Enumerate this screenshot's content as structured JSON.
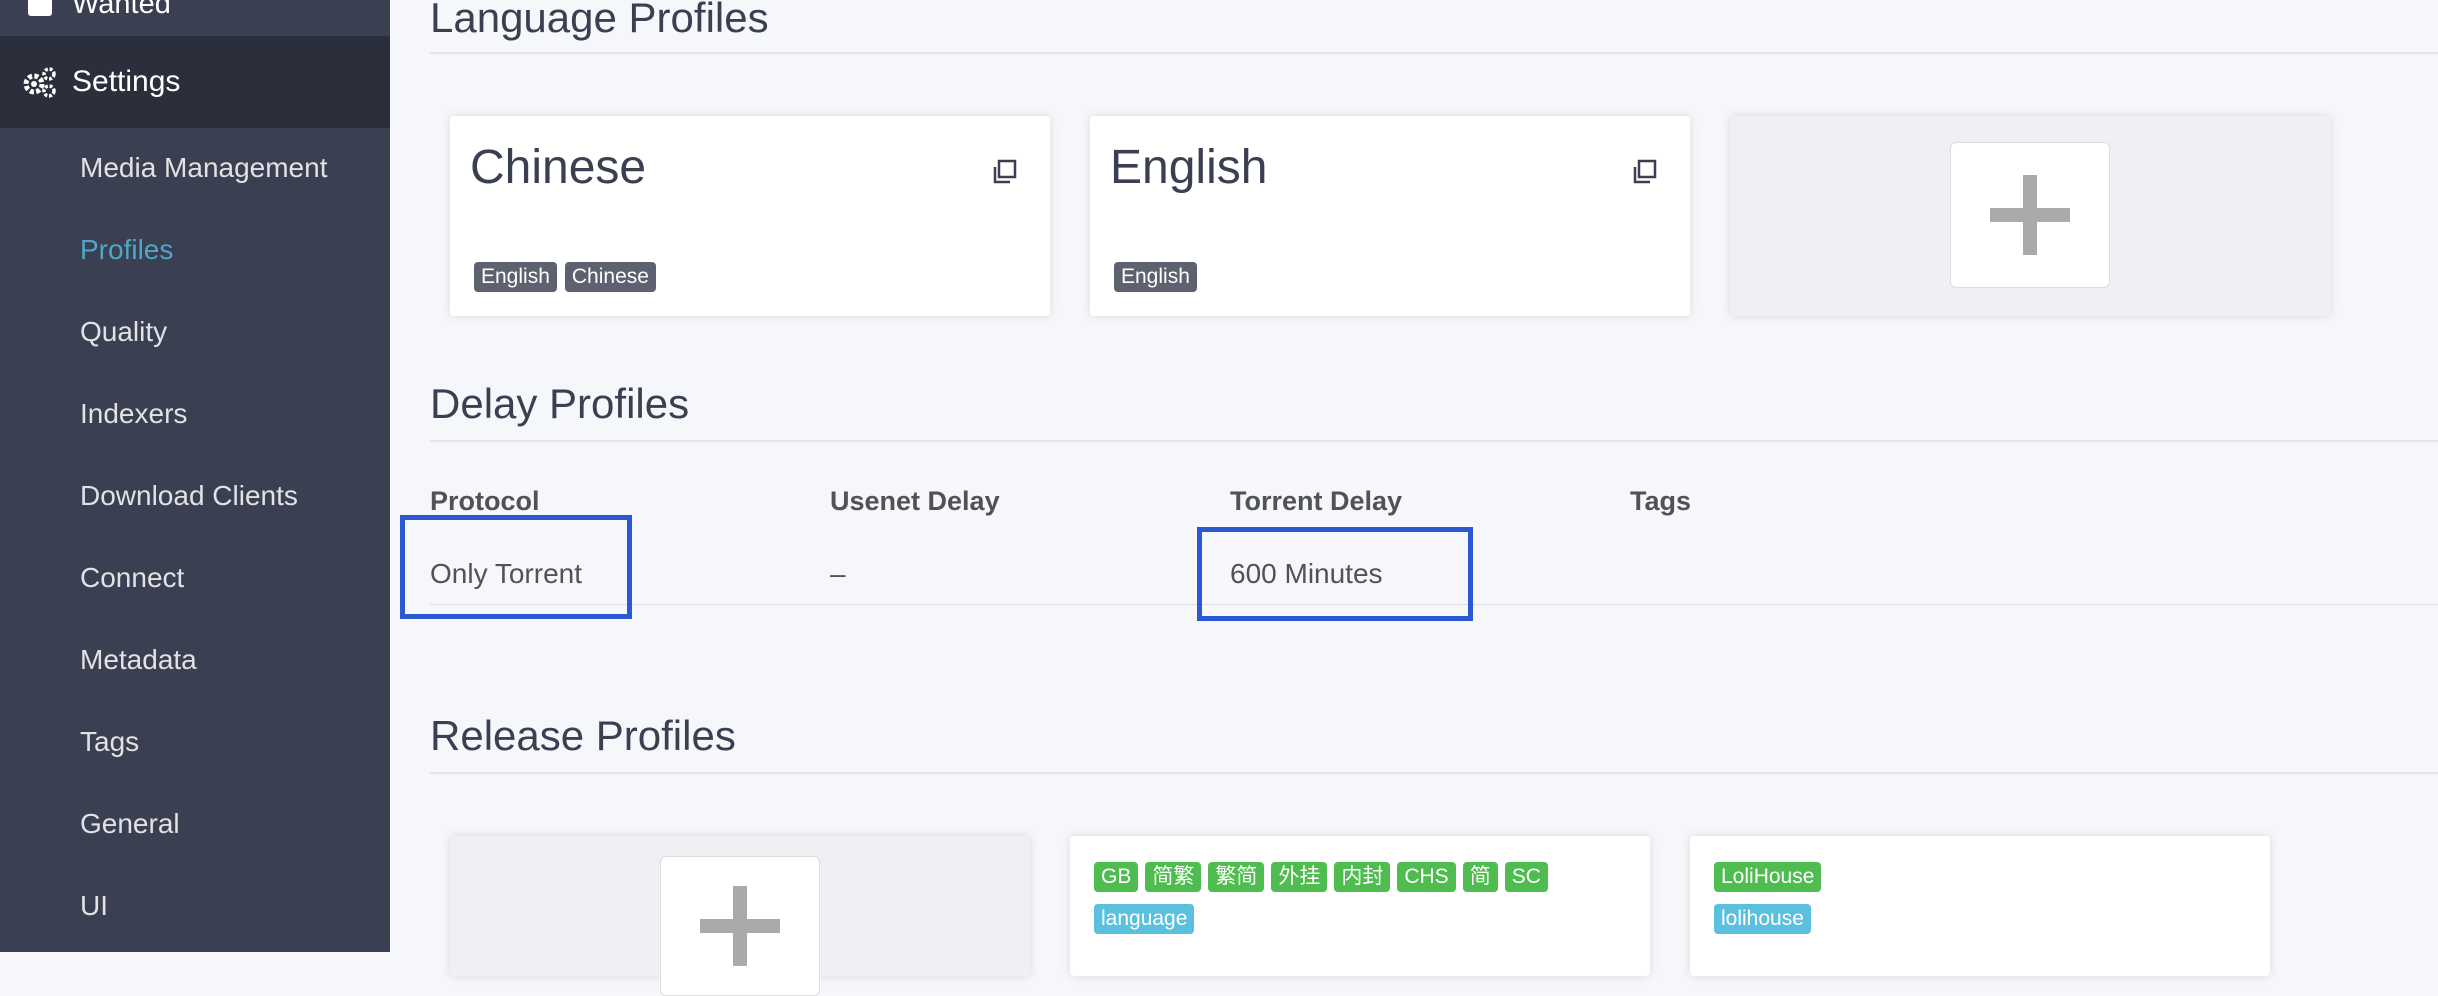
{
  "sidebar": {
    "top_item_label": "Wanted",
    "settings_label": "Settings",
    "items": [
      {
        "label": "Media Management"
      },
      {
        "label": "Profiles"
      },
      {
        "label": "Quality"
      },
      {
        "label": "Indexers"
      },
      {
        "label": "Download Clients"
      },
      {
        "label": "Connect"
      },
      {
        "label": "Metadata"
      },
      {
        "label": "Tags"
      },
      {
        "label": "General"
      },
      {
        "label": "UI"
      }
    ],
    "active_index": 1,
    "colors": {
      "background": "#3a3f51",
      "active_item": "#4fa6c7",
      "settings_bg": "#2b2f3c"
    }
  },
  "language_profiles": {
    "title": "Language Profiles",
    "cards": [
      {
        "name": "Chinese",
        "tags": [
          "English",
          "Chinese"
        ]
      },
      {
        "name": "English",
        "tags": [
          "English"
        ]
      }
    ],
    "add_icon": "plus-icon"
  },
  "delay_profiles": {
    "title": "Delay Profiles",
    "headers": [
      "Protocol",
      "Usenet Delay",
      "Torrent Delay",
      "Tags"
    ],
    "rows": [
      {
        "protocol": "Only Torrent",
        "usenet_delay": "–",
        "torrent_delay": "600 Minutes",
        "tags": ""
      }
    ],
    "highlight_color": "#2b59d1"
  },
  "release_profiles": {
    "title": "Release Profiles",
    "cards": [
      {
        "green_tags": [
          "GB",
          "简繁",
          "繁简",
          "外挂",
          "内封",
          "CHS",
          "简",
          "SC"
        ],
        "blue_tags": [
          "language"
        ]
      },
      {
        "green_tags": [
          "LoliHouse"
        ],
        "blue_tags": [
          "lolihouse"
        ]
      }
    ],
    "add_icon": "plus-icon"
  }
}
